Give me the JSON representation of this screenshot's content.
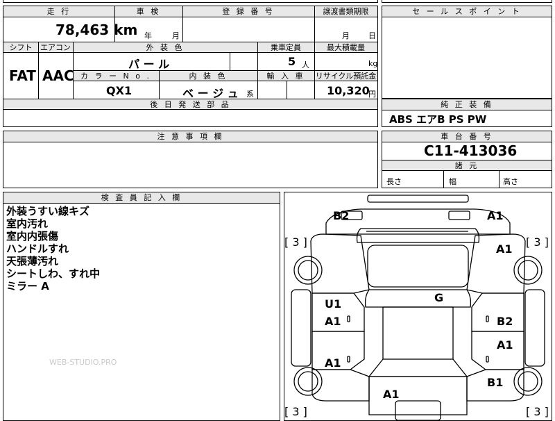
{
  "sheet": {
    "top_partial_text": "..."
  },
  "main": {
    "headers": {
      "mileage": "走 行",
      "inspection": "車 検",
      "registration_number": "登 録 番 号",
      "transfer_deadline": "譲渡書類期限",
      "shift": "シフト",
      "aircon": "エアコン",
      "exterior_color": "外 装 色",
      "capacity": "乗車定員",
      "max_load": "最大積載量",
      "color_no": "カ ラ ー N o .",
      "interior_color": "内 装 色",
      "import": "輸 入 車",
      "recycle": "リサイクル預託金",
      "later_parts": "後 日 発 送 部 品"
    },
    "values": {
      "mileage": "78,463",
      "mileage_unit": "km",
      "year_label": "年",
      "month_label": "月",
      "deadline_month": "月",
      "deadline_day": "日",
      "shift": "FAT",
      "aircon": "AAC",
      "exterior_color": "パ ー ル",
      "capacity": "5",
      "capacity_unit": "人",
      "load_unit": "kg",
      "color_no": "QX1",
      "interior_color": "ベ ー ジ ュ",
      "interior_suffix": "系",
      "recycle_amount": "10,320",
      "recycle_unit": "円"
    }
  },
  "sales_points": {
    "header": "セ ー ル ス ポ イ ン ト"
  },
  "standard_equipment": {
    "header": "純 正 装 備",
    "value": "ABS エアB PS PW"
  },
  "caution": {
    "header": "注 意 事 項 欄"
  },
  "chassis": {
    "header": "車 台 番 号",
    "value": "C11-413036",
    "dimensions_header": "諸 元",
    "length_label": "長さ",
    "width_label": "幅",
    "height_label": "高さ"
  },
  "inspector_notes": {
    "header": "検 査 員 記 入 欄",
    "lines": [
      "外装うすい線キズ",
      "室内汚れ",
      "室内内張傷",
      "ハンドルすれ",
      "天張薄汚れ",
      "シートしわ、すれ中",
      "ミラー A"
    ],
    "watermark": "WEB-STUDIO.PRO"
  },
  "damage_map": {
    "labels": {
      "front_left": "B2",
      "front_right": "A1",
      "right_front_fender": "A1",
      "left_front_door_upper": "U1",
      "left_front_door": "A1",
      "roof": "G",
      "right_front_door": "B2",
      "right_rear_door": "A1",
      "left_rear_door": "A1",
      "right_rear_quarter": "B1",
      "rear": "A1"
    },
    "tire_tread": {
      "front_left": "[ 3 ]",
      "front_right": "[ 3 ]",
      "rear_left": "[ 3 ]",
      "rear_right": "[ 3 ]"
    }
  }
}
